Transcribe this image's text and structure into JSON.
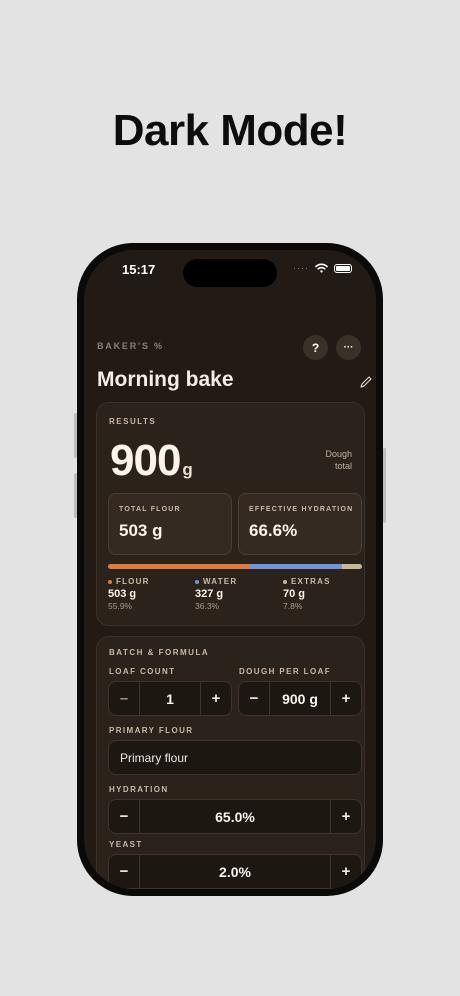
{
  "headline": "Dark Mode!",
  "status": {
    "time": "15:17",
    "signal": "····"
  },
  "app": {
    "label": "BAKER'S %",
    "help_label": "?",
    "more_label": "···",
    "title": "Morning bake"
  },
  "results": {
    "label": "RESULTS",
    "total_value": "900",
    "total_unit": "g",
    "total_caption_line1": "Dough",
    "total_caption_line2": "total",
    "total_flour_label": "TOTAL FLOUR",
    "total_flour_value": "503 g",
    "hydration_label": "EFFECTIVE HYDRATION",
    "hydration_value": "66.6%",
    "breakdown": [
      {
        "name": "FLOUR",
        "amount": "503 g",
        "percent": "55.9%",
        "color": "#e07b3c"
      },
      {
        "name": "WATER",
        "amount": "327 g",
        "percent": "36.3%",
        "color": "#6f95e0"
      },
      {
        "name": "EXTRAS",
        "amount": "70 g",
        "percent": "7.8%",
        "color": "#c8b896"
      }
    ],
    "bar_fractions": [
      0.559,
      0.363,
      0.078
    ]
  },
  "batch": {
    "label": "BATCH & FORMULA",
    "loaf_count_label": "LOAF COUNT",
    "loaf_count_value": "1",
    "dough_per_loaf_label": "DOUGH PER LOAF",
    "dough_per_loaf_value": "900 g",
    "primary_flour_label": "PRIMARY FLOUR",
    "primary_flour_value": "Primary flour",
    "hydration_label": "HYDRATION",
    "hydration_value": "65.0%",
    "yeast_label": "YEAST",
    "yeast_value": "2.0%",
    "minus": "−",
    "minus_alt": "–",
    "plus": "+"
  }
}
